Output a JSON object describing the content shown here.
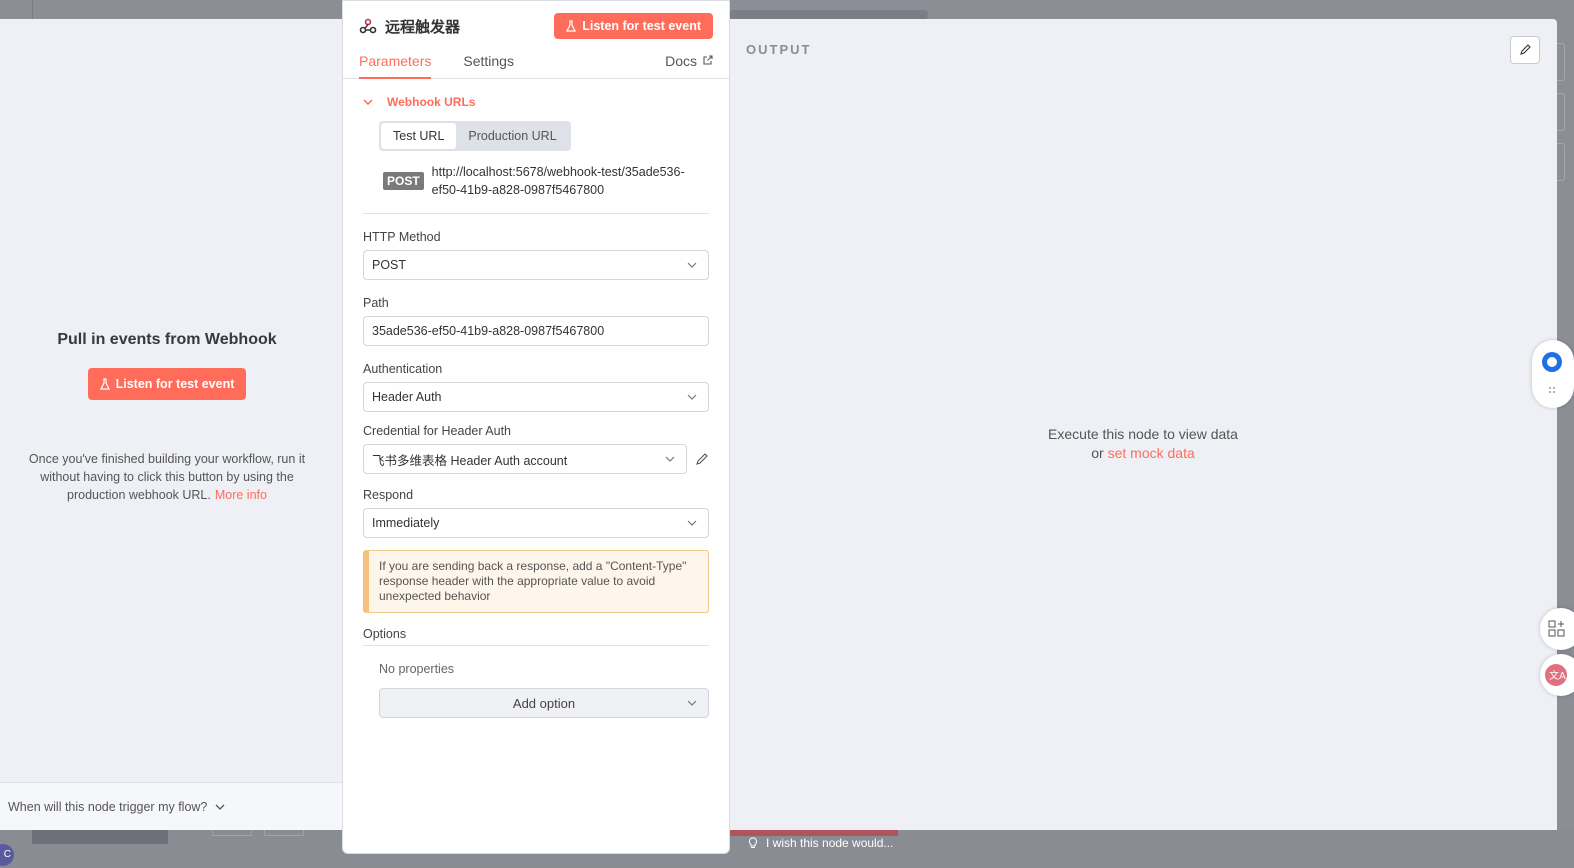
{
  "node": {
    "title": "远程触发器",
    "listen_label": "Listen for test event"
  },
  "tabs": [
    {
      "label": "Parameters"
    },
    {
      "label": "Settings"
    },
    {
      "label": "Docs"
    }
  ],
  "webhook": {
    "section_label": "Webhook URLs",
    "toggle": [
      "Test URL",
      "Production URL"
    ],
    "method_badge": "POST",
    "url": "http://localhost:5678/webhook-test/35ade536-ef50-41b9-a828-0987f5467800"
  },
  "fields": {
    "http_method": {
      "label": "HTTP Method",
      "value": "POST"
    },
    "path": {
      "label": "Path",
      "value": "35ade536-ef50-41b9-a828-0987f5467800"
    },
    "authentication": {
      "label": "Authentication",
      "value": "Header Auth"
    },
    "credential": {
      "label": "Credential for Header Auth",
      "value": "飞书多维表格 Header Auth account"
    },
    "respond": {
      "label": "Respond",
      "value": "Immediately"
    }
  },
  "notice": "If you are sending back a response, add a \"Content-Type\" response header with the appropriate value to avoid unexpected behavior",
  "options": {
    "label": "Options",
    "empty": "No properties",
    "add_label": "Add option"
  },
  "input_pane": {
    "title": "Pull in events from Webhook",
    "listen_label": "Listen for test event",
    "help": "Once you've finished building your workflow, run it without having to click this button by using the production webhook URL.",
    "more_info": "More info",
    "trigger_question": "When will this node trigger my flow?"
  },
  "output_pane": {
    "label": "OUTPUT",
    "execute_text": "Execute this node to view data",
    "or": "or",
    "mock_link": "set mock data"
  },
  "footer": {
    "wish": "I wish this node would..."
  },
  "colors": {
    "accent": "#ff6d5a",
    "notice_bg": "#fef6ea",
    "notice_border": "#f4c17f"
  }
}
